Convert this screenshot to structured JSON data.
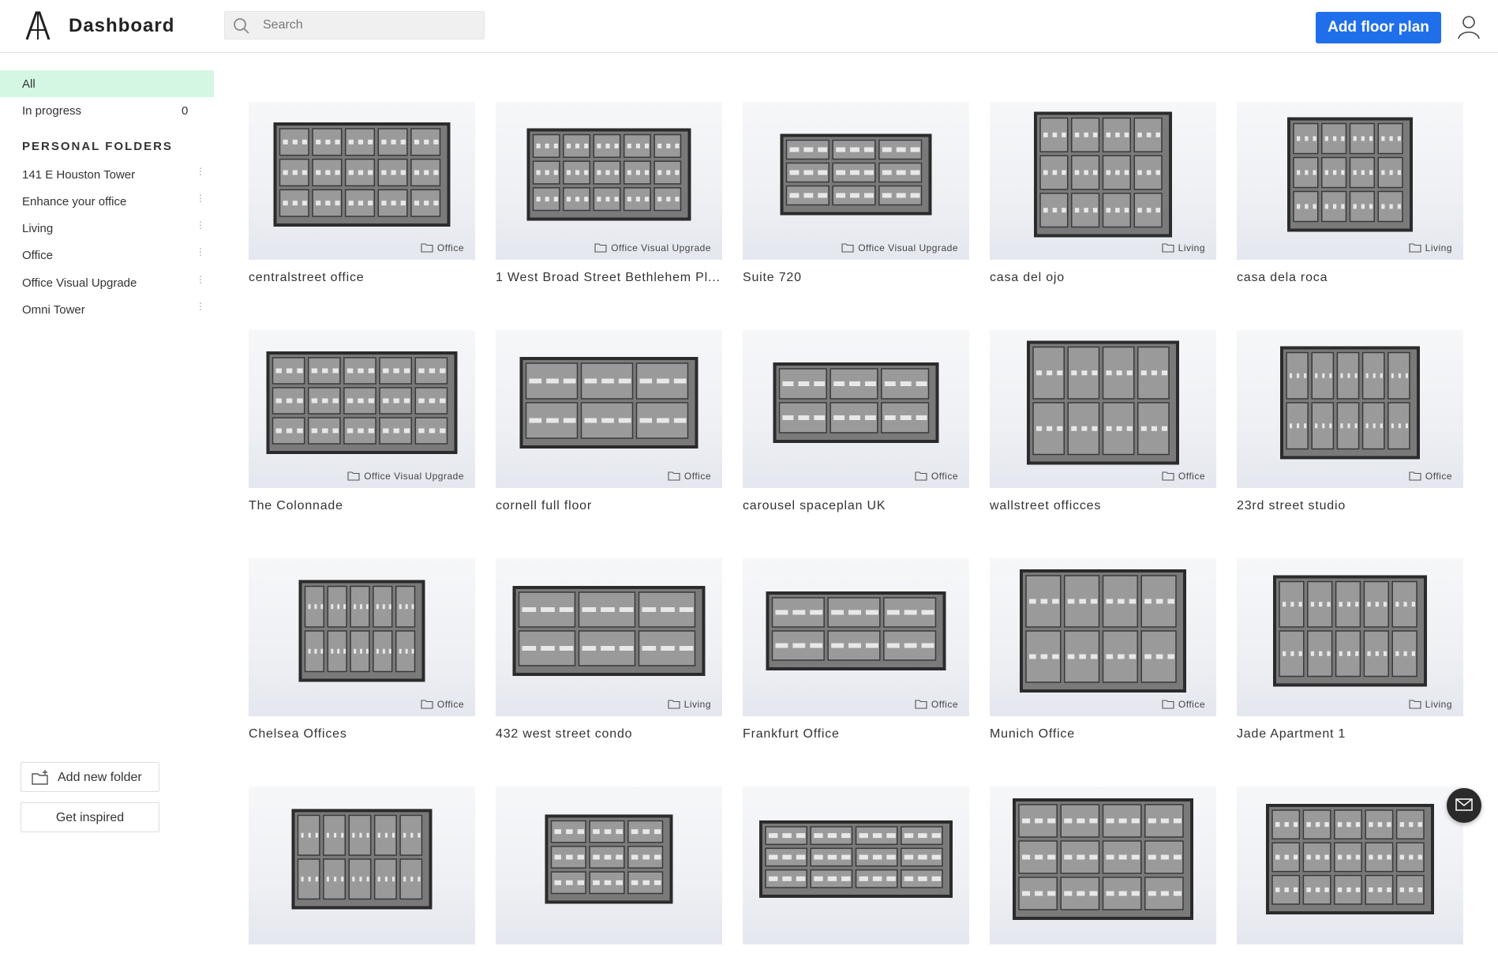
{
  "header": {
    "title": "Dashboard",
    "search_placeholder": "Search",
    "add_button": "Add floor plan"
  },
  "sidebar": {
    "nav": [
      {
        "label": "All",
        "count": ""
      },
      {
        "label": "In progress",
        "count": "0"
      }
    ],
    "section_title": "PERSONAL FOLDERS",
    "folders": [
      "141 E Houston Tower",
      "Enhance your office",
      "Living",
      "Office",
      "Office Visual Upgrade",
      "Omni Tower"
    ],
    "add_folder": "Add new folder",
    "get_inspired": "Get inspired"
  },
  "projects": [
    {
      "title": "centralstreet office",
      "tag": "Office"
    },
    {
      "title": "1 West Broad Street Bethlehem Pl...",
      "tag": "Office Visual Upgrade"
    },
    {
      "title": "Suite 720",
      "tag": "Office Visual Upgrade"
    },
    {
      "title": "casa del ojo",
      "tag": "Living"
    },
    {
      "title": "casa dela roca",
      "tag": "Living"
    },
    {
      "title": "The Colonnade",
      "tag": "Office Visual Upgrade"
    },
    {
      "title": "cornell full floor",
      "tag": "Office"
    },
    {
      "title": "carousel spaceplan UK",
      "tag": "Office"
    },
    {
      "title": "wallstreet officces",
      "tag": "Office"
    },
    {
      "title": "23rd street studio",
      "tag": "Office"
    },
    {
      "title": "Chelsea Offices",
      "tag": "Office"
    },
    {
      "title": "432 west street condo",
      "tag": "Living"
    },
    {
      "title": "Frankfurt Office",
      "tag": "Office"
    },
    {
      "title": "Munich Office",
      "tag": "Office"
    },
    {
      "title": "Jade Apartment 1",
      "tag": "Living"
    },
    {
      "title": "",
      "tag": ""
    },
    {
      "title": "",
      "tag": ""
    },
    {
      "title": "",
      "tag": ""
    },
    {
      "title": "",
      "tag": ""
    },
    {
      "title": "",
      "tag": ""
    }
  ],
  "colors": {
    "accent": "#1f6fea",
    "active_nav": "#d3f7e3"
  }
}
